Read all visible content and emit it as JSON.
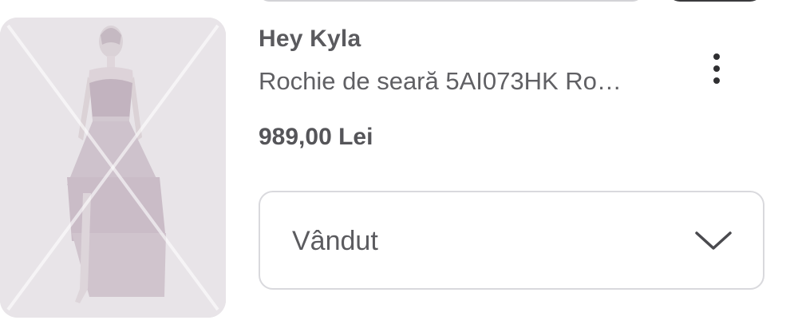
{
  "product": {
    "brand": "Hey Kyla",
    "title": "Rochie de seară 5AI073HK Ro…",
    "price": "989,00 Lei",
    "thumbnail_icon": "crossed-out-image-icon",
    "more_icon": "more-vertical-icon"
  },
  "status_select": {
    "value": "Vândut",
    "icon": "chevron-down-icon"
  },
  "colors": {
    "thumbnail_bg": "#e3dfe3",
    "dress": "#c7b8c4",
    "text": "#5a5a5e"
  }
}
